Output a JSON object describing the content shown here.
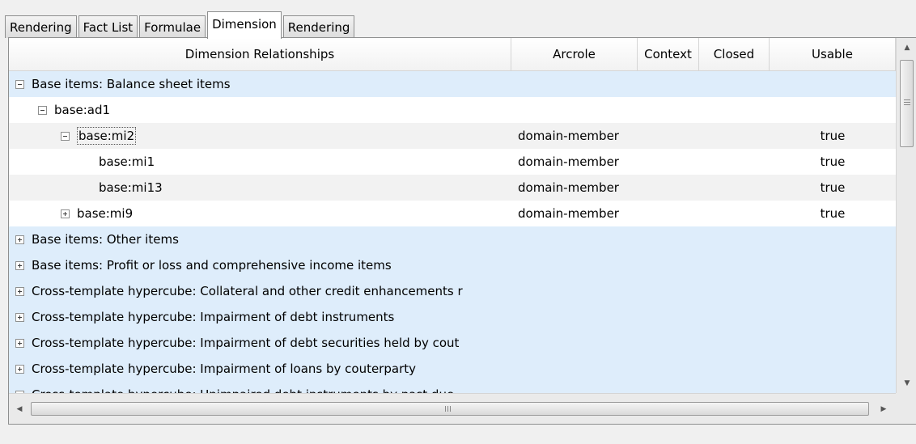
{
  "tabs": [
    {
      "label": "Rendering"
    },
    {
      "label": "Fact List"
    },
    {
      "label": "Formulae"
    },
    {
      "label": "Dimension"
    },
    {
      "label": "Rendering"
    }
  ],
  "active_tab": "Dimension",
  "columns": {
    "relationships": "Dimension Relationships",
    "arcrole": "Arcrole",
    "context": "Context",
    "closed": "Closed",
    "usable": "Usable"
  },
  "rows": [
    {
      "label": "Base items: Balance sheet items",
      "level": 0,
      "expander": "minus",
      "arcrole": "",
      "usable": "",
      "style": "hl"
    },
    {
      "label": "base:ad1",
      "level": 1,
      "expander": "minus",
      "arcrole": "",
      "usable": "",
      "style": "plain"
    },
    {
      "label": "base:mi2",
      "level": 2,
      "expander": "minus",
      "arcrole": "domain-member",
      "usable": "true",
      "style": "alt",
      "focused": true
    },
    {
      "label": "base:mi1",
      "level": 3,
      "expander": "none",
      "arcrole": "domain-member",
      "usable": "true",
      "style": "plain"
    },
    {
      "label": "base:mi13",
      "level": 3,
      "expander": "none",
      "arcrole": "domain-member",
      "usable": "true",
      "style": "alt"
    },
    {
      "label": "base:mi9",
      "level": 2,
      "expander": "plus",
      "arcrole": "domain-member",
      "usable": "true",
      "style": "plain"
    },
    {
      "label": "Base items: Other items",
      "level": 0,
      "expander": "plus",
      "arcrole": "",
      "usable": "",
      "style": "hl"
    },
    {
      "label": "Base items: Profit or loss and comprehensive income items",
      "level": 0,
      "expander": "plus",
      "arcrole": "",
      "usable": "",
      "style": "hl"
    },
    {
      "label": "Cross-template hypercube: Collateral and other credit enhancements r",
      "level": 0,
      "expander": "plus",
      "arcrole": "",
      "usable": "",
      "style": "hl"
    },
    {
      "label": "Cross-template hypercube: Impairment of debt instruments",
      "level": 0,
      "expander": "plus",
      "arcrole": "",
      "usable": "",
      "style": "hl"
    },
    {
      "label": "Cross-template hypercube: Impairment of debt securities held by cout",
      "level": 0,
      "expander": "plus",
      "arcrole": "",
      "usable": "",
      "style": "hl"
    },
    {
      "label": "Cross-template hypercube: Impairment of loans by couterparty",
      "level": 0,
      "expander": "plus",
      "arcrole": "",
      "usable": "",
      "style": "hl"
    },
    {
      "label": "Cross-template hypercube: Unimpaired debt instruments by past due",
      "level": 0,
      "expander": "plus",
      "arcrole": "",
      "usable": "",
      "style": "hl"
    }
  ],
  "icons": {
    "scroll_up": "arrow-up-icon",
    "scroll_down": "arrow-down-icon",
    "scroll_left": "arrow-left-icon",
    "scroll_right": "arrow-right-icon"
  },
  "colors": {
    "highlight_row": "#deedfb",
    "alt_row": "#f2f2f2"
  }
}
